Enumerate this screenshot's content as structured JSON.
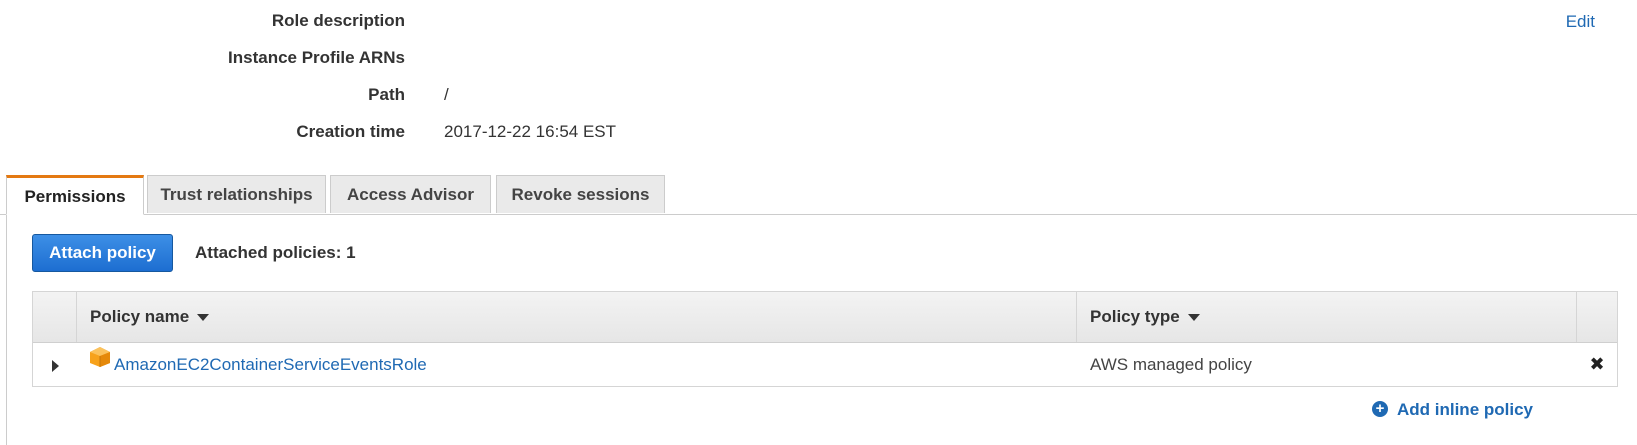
{
  "summary": {
    "edit_label": "Edit",
    "rows": [
      {
        "label": "Role description",
        "value": ""
      },
      {
        "label": "Instance Profile ARNs",
        "value": ""
      },
      {
        "label": "Path",
        "value": "/"
      },
      {
        "label": "Creation time",
        "value": "2017-12-22 16:54 EST"
      }
    ]
  },
  "tabs": [
    {
      "label": "Permissions",
      "active": true
    },
    {
      "label": "Trust relationships",
      "active": false
    },
    {
      "label": "Access Advisor",
      "active": false
    },
    {
      "label": "Revoke sessions",
      "active": false
    }
  ],
  "permissions": {
    "attach_button": "Attach policy",
    "attached_count": "Attached policies: 1",
    "table": {
      "headers": {
        "name": "Policy name",
        "type": "Policy type"
      },
      "rows": [
        {
          "name": "AmazonEC2ContainerServiceEventsRole",
          "type": "AWS managed policy",
          "icon": "aws-package-icon",
          "remove_icon": "close-icon"
        }
      ]
    },
    "add_inline_label": "Add inline policy",
    "add_inline_icon": "plus-circle-icon"
  },
  "colors": {
    "link": "#1f69b3",
    "active_tab_accent": "#e47911",
    "primary_button": "#1d6ed1"
  }
}
